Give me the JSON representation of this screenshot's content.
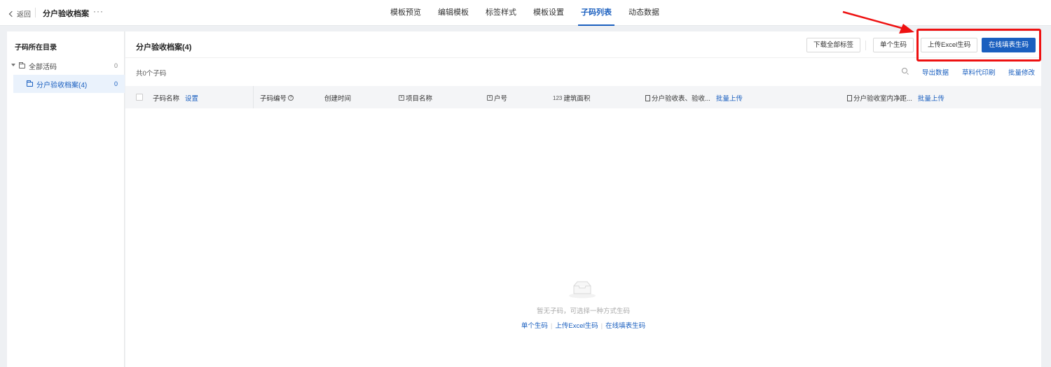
{
  "header": {
    "back_label": "返回",
    "title": "分户验收档案",
    "more_label": "···",
    "tabs": [
      {
        "label": "模板预览",
        "active": false
      },
      {
        "label": "编辑模板",
        "active": false
      },
      {
        "label": "标签样式",
        "active": false
      },
      {
        "label": "模板设置",
        "active": false
      },
      {
        "label": "子码列表",
        "active": true
      },
      {
        "label": "动态数据",
        "active": false
      }
    ]
  },
  "sidebar": {
    "title": "子码所在目录",
    "items": [
      {
        "label": "全部活码",
        "count": "0"
      },
      {
        "label": "分户验收档案(4)",
        "count": "0",
        "selected": true
      }
    ]
  },
  "main": {
    "title": "分户验收档案(4)",
    "buttons": {
      "download_all": "下载全部标签",
      "single": "单个生码",
      "excel": "上传Excel生码",
      "online": "在线填表生码"
    },
    "total": "共0个子码",
    "actions": {
      "export": "导出数据",
      "print": "草料代印刷",
      "batch_edit": "批量修改"
    },
    "table": {
      "columns": {
        "name": "子码名称",
        "name_link": "设置",
        "code": "子码编号",
        "created": "创建时间",
        "project": "项目名称",
        "household": "户号",
        "area_prefix": "123",
        "area": "建筑面积",
        "file1": "分户验收表、验收...",
        "file1_link": "批量上传",
        "file2": "分户验收室内净距...",
        "file2_link": "批量上传"
      }
    },
    "empty": {
      "text": "暂无子码，可选择一种方式生码",
      "links": [
        "单个生码",
        "上传Excel生码",
        "在线填表生码"
      ]
    }
  },
  "colors": {
    "accent": "#1a5fbf",
    "annotation": "#ee1111"
  }
}
